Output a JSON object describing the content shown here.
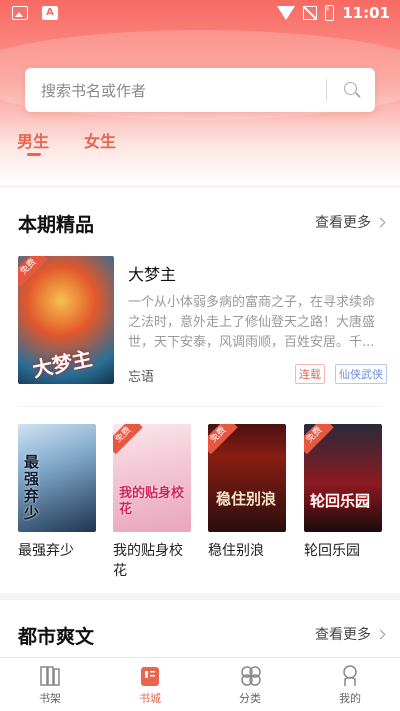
{
  "status_bar": {
    "time": "11:01",
    "left_icons": [
      "image-icon",
      "pdf-icon"
    ],
    "right_icons": [
      "wifi-icon",
      "no-signal-icon",
      "battery-charging-icon"
    ]
  },
  "search": {
    "placeholder": "搜索书名或作者",
    "button_icon": "search-icon"
  },
  "gender_tabs": [
    {
      "label": "男生",
      "active": true
    },
    {
      "label": "女生",
      "active": false
    }
  ],
  "section_featured": {
    "title": "本期精品",
    "more_label": "查看更多",
    "featured_book": {
      "title": "大梦主",
      "cover_text": "大梦主",
      "free_badge": "免费",
      "description": "一个从小体弱多病的富商之子，在寻求续命之法时，意外走上了修仙登天之路！大唐盛世，天下安泰，风调雨顺，百姓安居。千...",
      "author": "忘语",
      "status_tag": "连载",
      "genre_tag": "仙侠武侠"
    },
    "books": [
      {
        "title": "最强弃少",
        "cover_text": "最强弃少",
        "free_badge": ""
      },
      {
        "title": "我的贴身校花",
        "cover_text": "我的贴身校花",
        "free_badge": "免费"
      },
      {
        "title": "稳住别浪",
        "cover_text": "稳住别浪",
        "free_badge": "免费"
      },
      {
        "title": "轮回乐园",
        "cover_text": "轮回乐园",
        "free_badge": "免费"
      }
    ]
  },
  "section_urban": {
    "title": "都市爽文",
    "more_label": "查看更多"
  },
  "bottom_nav": [
    {
      "label": "书架",
      "icon": "bookshelf-icon",
      "active": false
    },
    {
      "label": "书城",
      "icon": "book-store-icon",
      "active": true
    },
    {
      "label": "分类",
      "icon": "category-icon",
      "active": false
    },
    {
      "label": "我的",
      "icon": "profile-icon",
      "active": false
    }
  ],
  "colors": {
    "accent": "#e8664e",
    "header_gradient_top": "#f86a63"
  }
}
